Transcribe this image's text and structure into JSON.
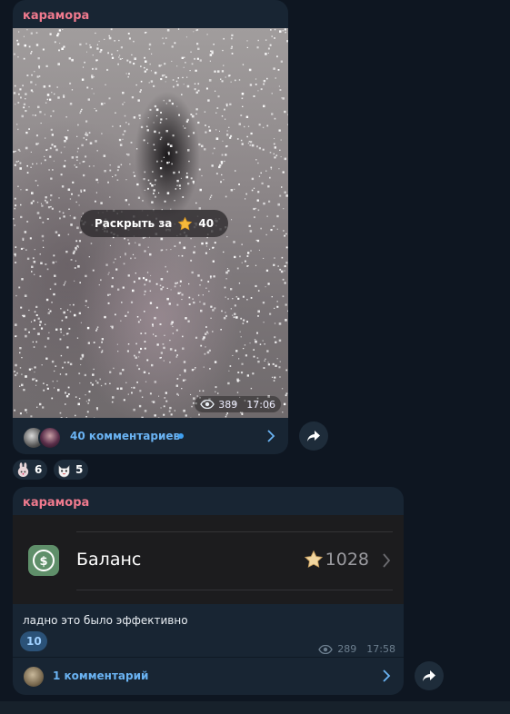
{
  "post1": {
    "author": "карамора",
    "reveal_label": "Раскрыть за",
    "reveal_price": "40",
    "views": "389",
    "time": "17:06",
    "comments_label": "40 комментариев",
    "reactions": [
      {
        "icon": "bunny-emoji-icon",
        "count": "6"
      },
      {
        "icon": "cat-face-emoji-icon",
        "count": "5"
      }
    ]
  },
  "post2": {
    "author": "карамора",
    "balance_label": "Баланс",
    "balance_value": "1028",
    "text": "ладно это было эффективно",
    "reaction": {
      "icon": "meme-face-emoji-icon",
      "count": "10"
    },
    "views": "289",
    "time": "17:58",
    "comments_label": "1 комментарий"
  },
  "colors": {
    "background": "#0e1621",
    "bubble": "#182533",
    "author": "#f07a8e",
    "link": "#6ab3f3",
    "unread_dot": "#3fa0f0"
  }
}
